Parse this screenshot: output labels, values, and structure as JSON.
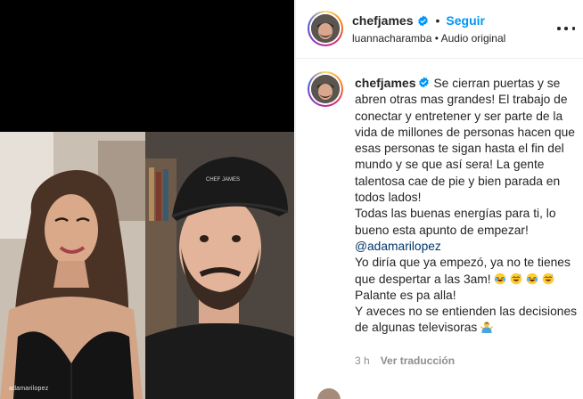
{
  "post": {
    "author": "chefjames",
    "follow_label": "Seguir",
    "dot": "•",
    "audio_line": "luannacharamba • Audio original",
    "video_watermark": "adamarilopez"
  },
  "caption": {
    "author": "chefjames",
    "text_1": "Se cierran puertas y se abren otras mas grandes! El trabajo de conectar y entretener y ser parte de la vida de millones de personas hacen que esas personas te sigan hasta el fin del mundo y se que así sera! La gente talentosa cae de pie y bien parada en todos lados!",
    "text_2": "Todas las buenas energías para ti, lo bueno esta apunto de empezar!",
    "mention": "@adamarilopez",
    "text_3": "Yo diría que ya empezó, ya no te tienes que despertar a las 3am!",
    "text_4": "Palante es pa alla!",
    "text_5": "Y aveces no se entienden las decisiones de algunas televisoras"
  },
  "meta": {
    "time": "3 h",
    "translate_label": "Ver traducción"
  },
  "colors": {
    "follow_blue": "#0095f6",
    "verified_blue": "#0095f6",
    "mention_blue": "#00376b",
    "meta_gray": "#8e8e8e"
  },
  "icons": [
    "verified-badge-icon",
    "more-options-icon",
    "laughing-emoji-icon",
    "sweat-smile-emoji-icon",
    "shrug-emoji-icon"
  ]
}
